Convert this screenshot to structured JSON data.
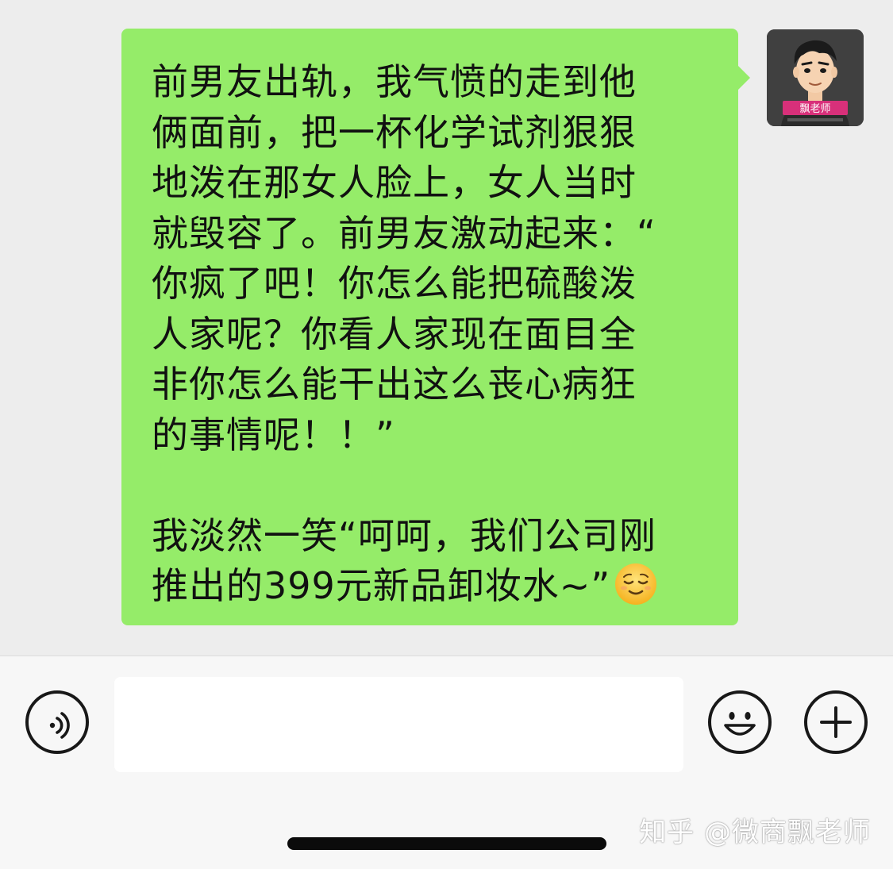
{
  "chat": {
    "message": {
      "text": "前男友出轨，我气愤的走到他\n俩面前，把一杯化学试剂狠狠\n地泼在那女人脸上，女人当时\n就毁容了。前男友激动起来：“\n你疯了吧！你怎么能把硫酸泼\n人家呢？你看人家现在面目全\n非你怎么能干出这么丧心病狂\n的事情呢！！”\n\n我淡然一笑“呵呵，我们公司刚\n推出的399元新品卸妆水~”",
      "emoji_icon": "relieved-face-emoji"
    },
    "avatar": {
      "badge_label": "飘老师",
      "colors": {
        "background": "#3a3a3a",
        "badge": "#d8307a"
      }
    }
  },
  "input_bar": {
    "voice_icon": "voice-icon",
    "input_value": "",
    "emoji_icon": "smiley-face-icon",
    "add_icon": "plus-circle-icon"
  },
  "watermark": "知乎 @微商飘老师",
  "colors": {
    "bubble": "#95ec69",
    "chat_background": "#ededed",
    "input_bar_background": "#f7f7f7"
  }
}
